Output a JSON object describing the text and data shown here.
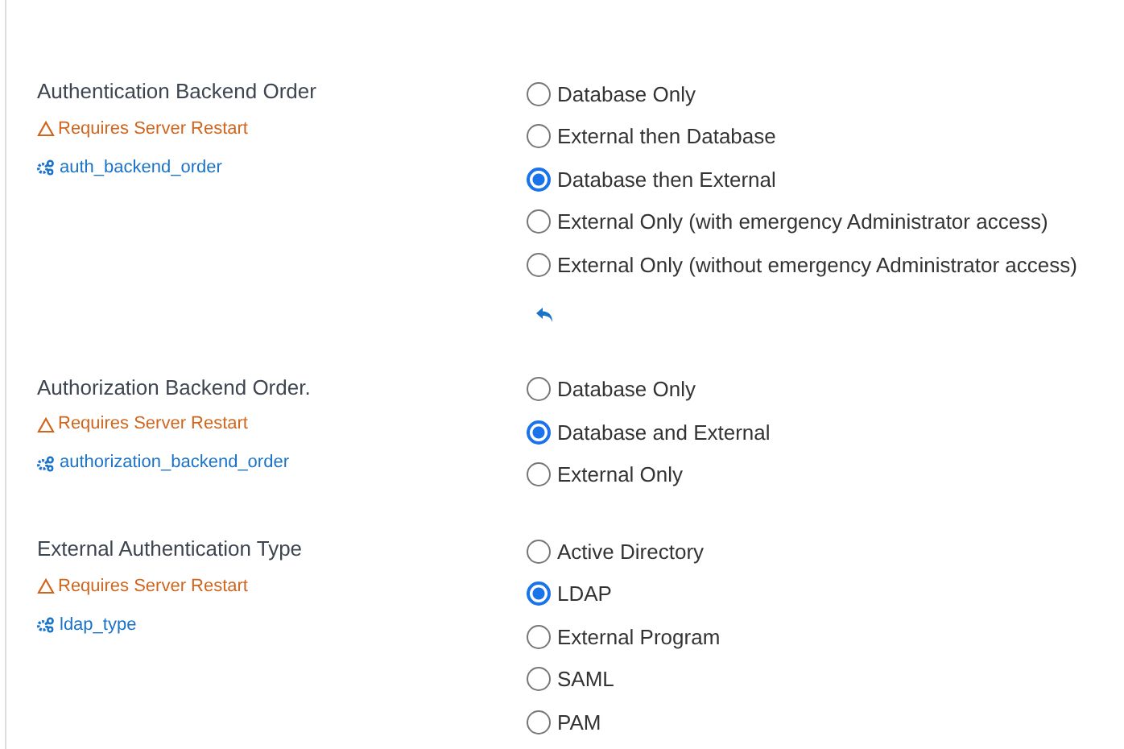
{
  "settings": [
    {
      "title": "Authentication Backend Order",
      "warning": "Requires Server Restart",
      "key": "auth_backend_order",
      "undo": true,
      "options": [
        {
          "label": "Database Only",
          "selected": false
        },
        {
          "label": "External then Database",
          "selected": false
        },
        {
          "label": "Database then External",
          "selected": true
        },
        {
          "label": "External Only (with emergency Administrator access)",
          "selected": false
        },
        {
          "label": "External Only (without emergency Administrator access)",
          "selected": false
        }
      ]
    },
    {
      "title": "Authorization Backend Order.",
      "warning": "Requires Server Restart",
      "key": "authorization_backend_order",
      "undo": false,
      "options": [
        {
          "label": "Database Only",
          "selected": false
        },
        {
          "label": "Database and External",
          "selected": true
        },
        {
          "label": "External Only",
          "selected": false
        }
      ]
    },
    {
      "title": "External Authentication Type",
      "warning": "Requires Server Restart",
      "key": "ldap_type",
      "undo": false,
      "options": [
        {
          "label": "Active Directory",
          "selected": false
        },
        {
          "label": "LDAP",
          "selected": true
        },
        {
          "label": "External Program",
          "selected": false
        },
        {
          "label": "SAML",
          "selected": false
        },
        {
          "label": "PAM",
          "selected": false
        }
      ]
    }
  ]
}
